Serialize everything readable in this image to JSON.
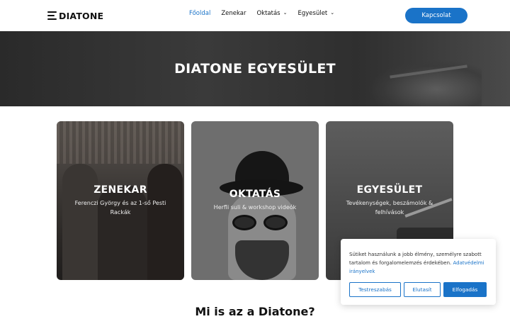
{
  "header": {
    "logo_text": "DIATONE",
    "nav": [
      {
        "label": "Főoldal",
        "active": true,
        "dropdown": false
      },
      {
        "label": "Zenekar",
        "active": false,
        "dropdown": false
      },
      {
        "label": "Oktatás",
        "active": false,
        "dropdown": true
      },
      {
        "label": "Egyesület",
        "active": false,
        "dropdown": true
      }
    ],
    "cta_label": "Kapcsolat"
  },
  "hero": {
    "title": "DIATONE EGYESÜLET"
  },
  "cards": [
    {
      "title": "ZENEKAR",
      "subtitle": "Ferenczi György és az 1-ső Pesti Rackák"
    },
    {
      "title": "OKTATÁS",
      "subtitle": "Herfli suli & workshop videók"
    },
    {
      "title": "EGYESÜLET",
      "subtitle": "Tevékenységek, beszámolók & felhívások"
    }
  ],
  "section": {
    "title": "Mi is az a Diatone?"
  },
  "cookie": {
    "text": "Sütiket használunk a jobb élmény, személyre szabott tartalom és forgalomelemzés érdekében.",
    "link": "Adatvédelmi irányelvek",
    "buttons": {
      "customize": "Testreszabás",
      "reject": "Elutasít",
      "accept": "Elfogadás"
    }
  },
  "colors": {
    "accent": "#1a73c8"
  }
}
